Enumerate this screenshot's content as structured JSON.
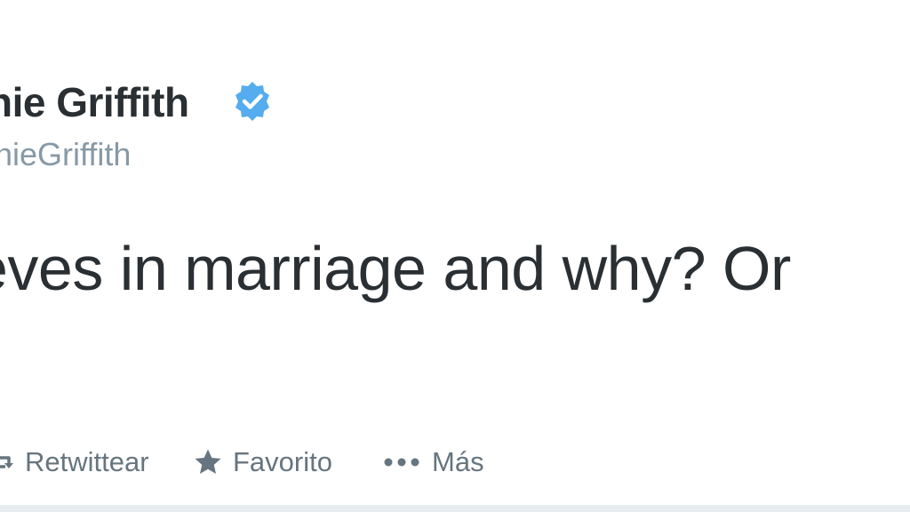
{
  "tweet": {
    "display_name": "nie Griffith",
    "handle": "nieGriffith",
    "text": "eves in marriage and why? Or",
    "verified": true
  },
  "actions": {
    "retweet_label": "Retwittear",
    "favorite_label": "Favorito",
    "more_label": "Más"
  },
  "icons": {
    "retweet": "retweet-icon",
    "favorite": "star-icon",
    "more": "ellipsis-icon",
    "verified": "verified-badge-icon"
  },
  "colors": {
    "text": "#292f33",
    "muted": "#8899a6",
    "action": "#66757f",
    "verified_blue": "#55acee"
  }
}
